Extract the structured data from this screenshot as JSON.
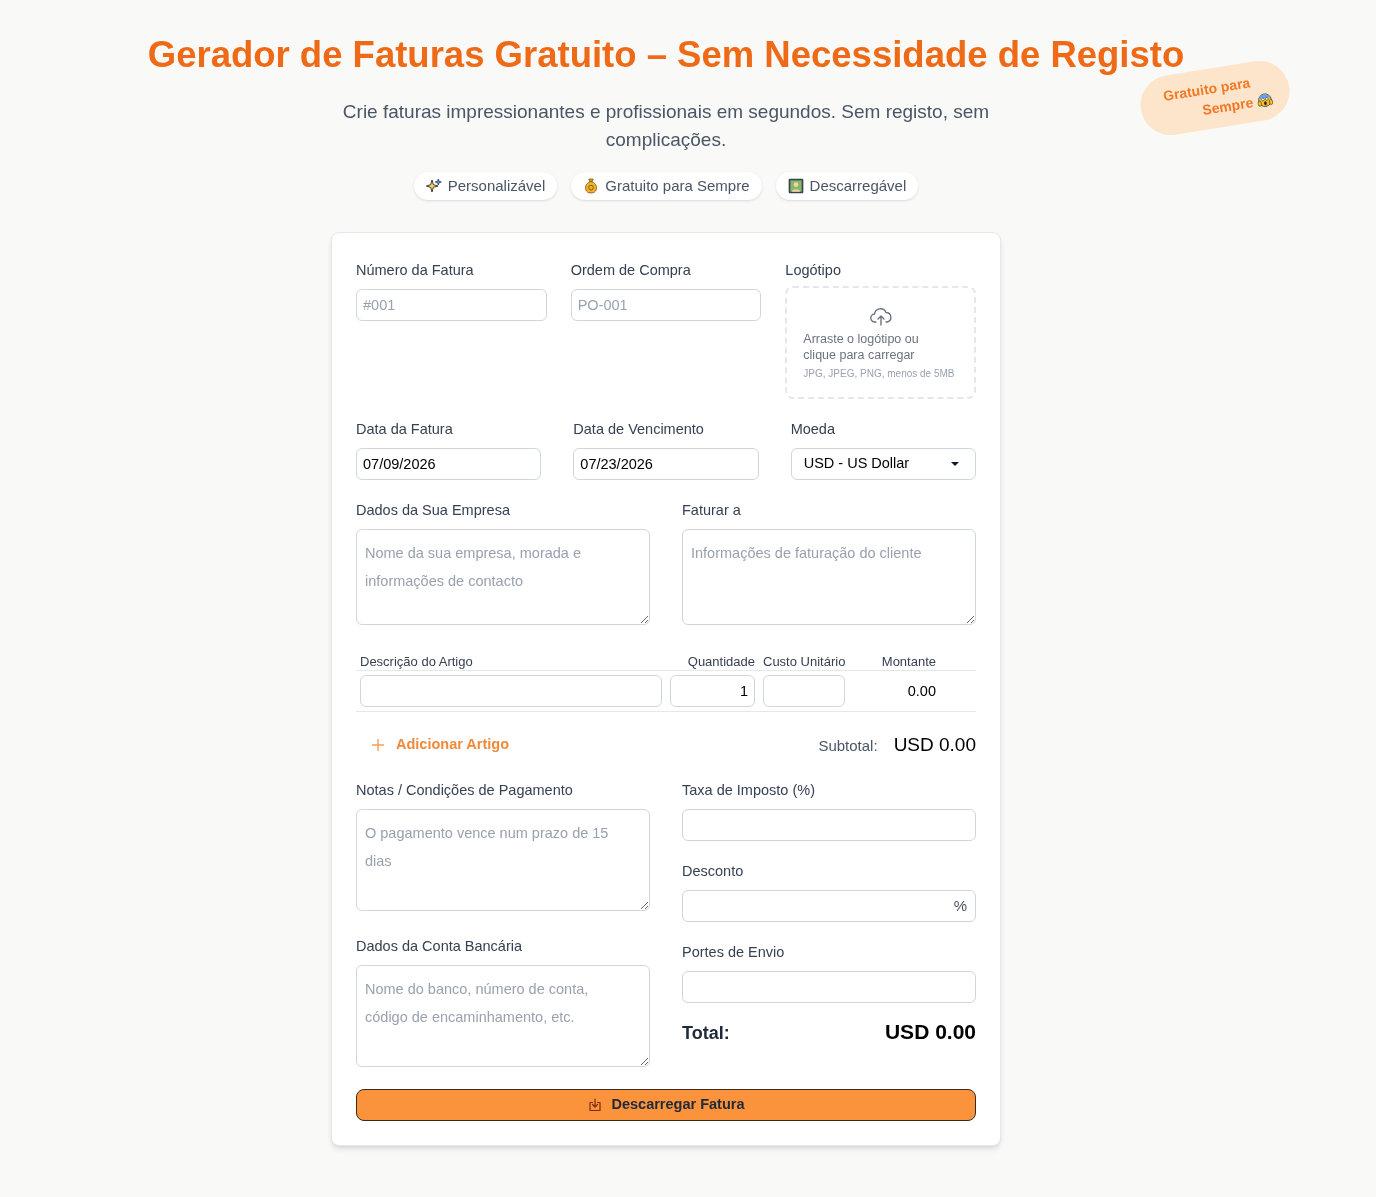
{
  "header": {
    "title": "Gerador de Faturas Gratuito – Sem Necessidade de Registo",
    "subtitle": "Crie faturas impressionantes e profissionais em segundos. Sem registo, sem complicações.",
    "sticker": "Gratuito para Sempre"
  },
  "features": [
    {
      "kind": "sparkles",
      "label": "Personalizável"
    },
    {
      "kind": "moneybag",
      "label": "Gratuito para Sempre"
    },
    {
      "kind": "picture",
      "label": "Descarregável"
    }
  ],
  "form": {
    "invoice_number": {
      "label": "Número da Fatura",
      "placeholder": "#001"
    },
    "purchase_order": {
      "label": "Ordem de Compra",
      "placeholder": "PO-001"
    },
    "logo": {
      "label": "Logótipo",
      "prompt": "Arraste o logótipo ou clique para carregar",
      "hint": "JPG, JPEG, PNG, menos de 5MB"
    },
    "invoice_date": {
      "label": "Data da Fatura",
      "value": "07/09/2026"
    },
    "due_date": {
      "label": "Data de Vencimento",
      "value": "07/23/2026"
    },
    "currency": {
      "label": "Moeda",
      "value": "USD - US Dollar"
    },
    "company": {
      "label": "Dados da Sua Empresa",
      "placeholder": "Nome da sua empresa, morada e informações de contacto"
    },
    "bill_to": {
      "label": "Faturar a",
      "placeholder": "Informações de faturação do cliente"
    }
  },
  "items": {
    "columns": [
      "Descrição do Artigo",
      "Quantidade",
      "Custo Unitário",
      "Montante"
    ],
    "rows": [
      {
        "quantity": "1",
        "amount": "0.00"
      }
    ],
    "add_button": "Adicionar Artigo",
    "subtotal_label": "Subtotal:",
    "subtotal": "USD 0.00"
  },
  "extras": {
    "notes": {
      "label": "Notas / Condições de Pagamento",
      "placeholder": "O pagamento vence num prazo de 15 dias"
    },
    "bank": {
      "label": "Dados da Conta Bancária",
      "placeholder": "Nome do banco, número de conta, código de encaminhamento, etc."
    },
    "tax": {
      "label": "Taxa de Imposto (%)"
    },
    "discount": {
      "label": "Desconto",
      "suffix": "%"
    },
    "shipping": {
      "label": "Portes de Envio"
    },
    "total_label": "Total:",
    "total": "USD 0.00"
  },
  "download_button": "Descarregar Fatura"
}
